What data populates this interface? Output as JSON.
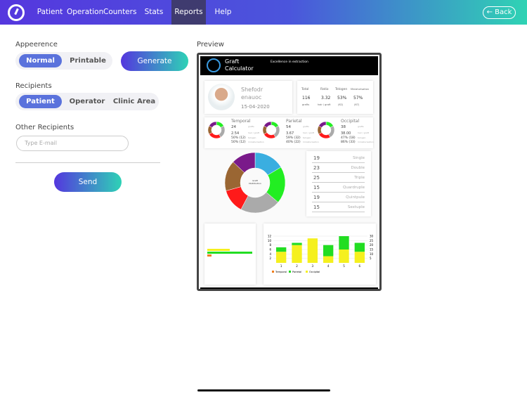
{
  "header": {
    "nav": [
      "Patient",
      "Operation",
      "Counters",
      "Stats",
      "Reports",
      "Help"
    ],
    "active": "Reports",
    "back_label": "← Back"
  },
  "left": {
    "appearance_label": "Appeerence",
    "appearance_options": [
      "Normal",
      "Printable"
    ],
    "appearance_selected": "Normal",
    "generate_label": "Generate",
    "recipients_label": "Recipients",
    "recipient_options": [
      "Patient",
      "Operator",
      "Clinic Area"
    ],
    "recipient_selected": "Patient",
    "other_label": "Other Recipients",
    "email_placeholder": "Type E-mail",
    "send_label": "Send"
  },
  "preview": {
    "label": "Preview",
    "brand": "Graft Calculator",
    "tagline": "Excellence in extraction",
    "patient": {
      "first": "Shefodr",
      "last": "enauoc",
      "date": "15-04-2020"
    },
    "stats": {
      "headers": [
        "Total",
        "Ratio",
        "Telogen",
        "Miniaturisation"
      ],
      "values": [
        "116",
        "3.32",
        "53%",
        "57%"
      ],
      "subs": [
        "grafts",
        "hair / graft",
        "(62)",
        "(67)"
      ]
    },
    "areas": [
      {
        "name": "Temporal",
        "grafts": "24",
        "ratio": "2.54",
        "telogen": "50% (12)",
        "mini": "50% (12)"
      },
      {
        "name": "Parietal",
        "grafts": "54",
        "ratio": "3.67",
        "telogen": "59% (32)",
        "mini": "40% (22)"
      },
      {
        "name": "Occipital",
        "grafts": "38",
        "ratio": "38.00",
        "telogen": "47% (18)",
        "mini": "86% (33)"
      }
    ],
    "area_sublabels": [
      "grafts",
      "hair / graft",
      "telogen",
      "miniaturisation"
    ],
    "donut_center": "Graft Distribution",
    "counts": [
      {
        "n": "19",
        "t": "Single"
      },
      {
        "n": "23",
        "t": "Double"
      },
      {
        "n": "25",
        "t": "Triple"
      },
      {
        "n": "15",
        "t": "Quardruple"
      },
      {
        "n": "19",
        "t": "Quintpule"
      },
      {
        "n": "15",
        "t": "Sextuple"
      }
    ],
    "legend": [
      "Temporal",
      "Parietal",
      "Occipital"
    ],
    "colors": {
      "temporal": "#f07f20",
      "parietal": "#22dd22",
      "occipital": "#f5f01e"
    }
  },
  "chart_data": {
    "type": "bar",
    "stacked": true,
    "categories": [
      "1",
      "2",
      "3",
      "4",
      "5",
      "6"
    ],
    "series": [
      {
        "name": "Occipital",
        "values": [
          5,
          8,
          11,
          3,
          6,
          5
        ]
      },
      {
        "name": "Parietal",
        "values": [
          2,
          1,
          0,
          5,
          6,
          4
        ]
      }
    ],
    "ylim": [
      0,
      12
    ],
    "yticks": [
      "2",
      "4",
      "6",
      "8",
      "10",
      "12"
    ],
    "y2ticks": [
      "5",
      "10",
      "15",
      "20",
      "25",
      "30"
    ]
  }
}
